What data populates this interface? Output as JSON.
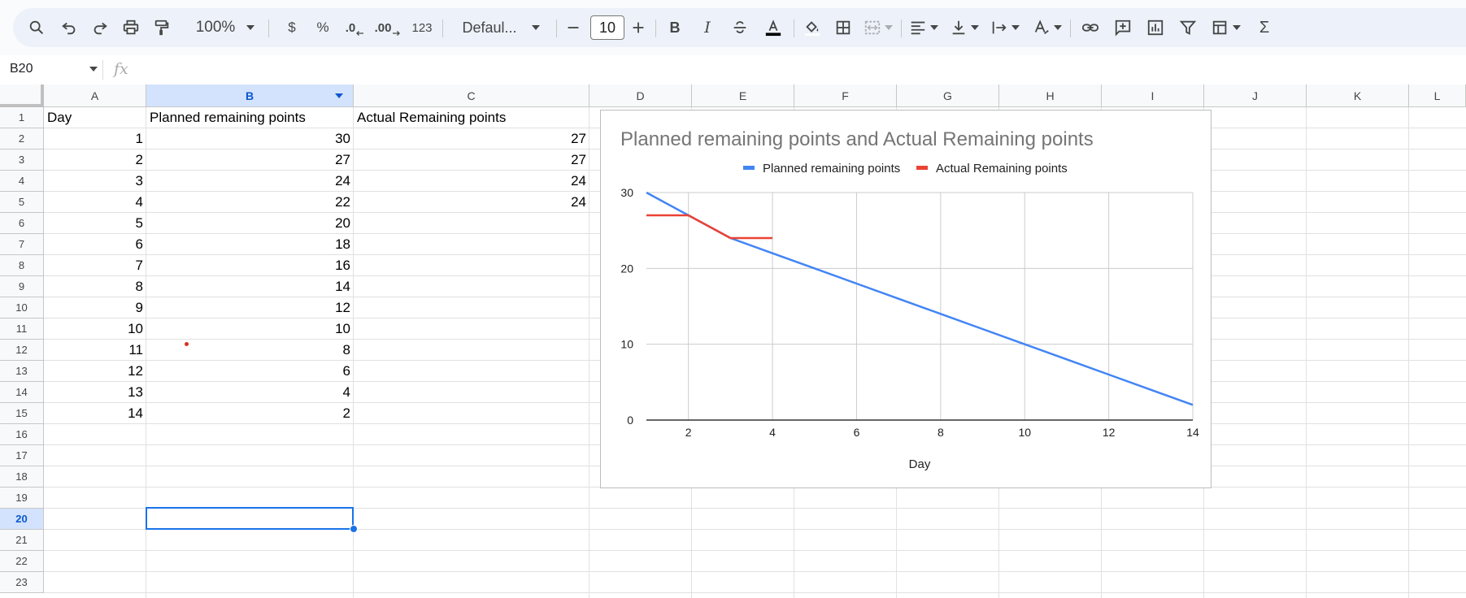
{
  "toolbar": {
    "zoom": "100%",
    "currency": "$",
    "percent": "%",
    "decrease_decimal": ".0",
    "increase_decimal": ".00",
    "number_format": "123",
    "font_name": "Defaul...",
    "font_size": "10",
    "bold": "B",
    "italic": "I",
    "sum": "Σ"
  },
  "formula_bar": {
    "cell_ref": "B20",
    "fx": "fx"
  },
  "columns": [
    "A",
    "B",
    "C",
    "D",
    "E",
    "F",
    "G",
    "H",
    "I",
    "J",
    "K",
    "L"
  ],
  "rows": [
    "1",
    "2",
    "3",
    "4",
    "5",
    "6",
    "7",
    "8",
    "9",
    "10",
    "11",
    "12",
    "13",
    "14",
    "15",
    "16",
    "17",
    "18",
    "19",
    "20",
    "21",
    "22",
    "23"
  ],
  "selected": {
    "column": "B",
    "row": "20"
  },
  "sheet": {
    "headers": [
      "Day",
      "Planned remaining points",
      "Actual Remaining points"
    ],
    "day": [
      "1",
      "2",
      "3",
      "4",
      "5",
      "6",
      "7",
      "8",
      "9",
      "10",
      "11",
      "12",
      "13",
      "14"
    ],
    "planned": [
      "30",
      "27",
      "24",
      "22",
      "20",
      "18",
      "16",
      "14",
      "12",
      "10",
      "8",
      "6",
      "4",
      "2"
    ],
    "actual": [
      "27",
      "27",
      "24",
      "24"
    ]
  },
  "colors": {
    "planned": "#4285f4",
    "actual": "#ea4335",
    "selection": "#1a73e8"
  },
  "chart_data": {
    "type": "line",
    "title": "Planned remaining points and Actual Remaining points",
    "xlabel": "Day",
    "ylabel": "",
    "xlim": [
      1,
      14
    ],
    "ylim": [
      0,
      30
    ],
    "x_ticks": [
      "2",
      "4",
      "6",
      "8",
      "10",
      "12",
      "14"
    ],
    "y_ticks": [
      "0",
      "10",
      "20",
      "30"
    ],
    "grid": true,
    "legend": "top",
    "series": [
      {
        "name": "Planned remaining points",
        "x": [
          1,
          2,
          3,
          4,
          5,
          6,
          7,
          8,
          9,
          10,
          11,
          12,
          13,
          14
        ],
        "values": [
          30,
          27,
          24,
          22,
          20,
          18,
          16,
          14,
          12,
          10,
          8,
          6,
          4,
          2
        ]
      },
      {
        "name": "Actual Remaining points",
        "x": [
          1,
          2,
          3,
          4
        ],
        "values": [
          27,
          27,
          24,
          24
        ]
      }
    ]
  }
}
